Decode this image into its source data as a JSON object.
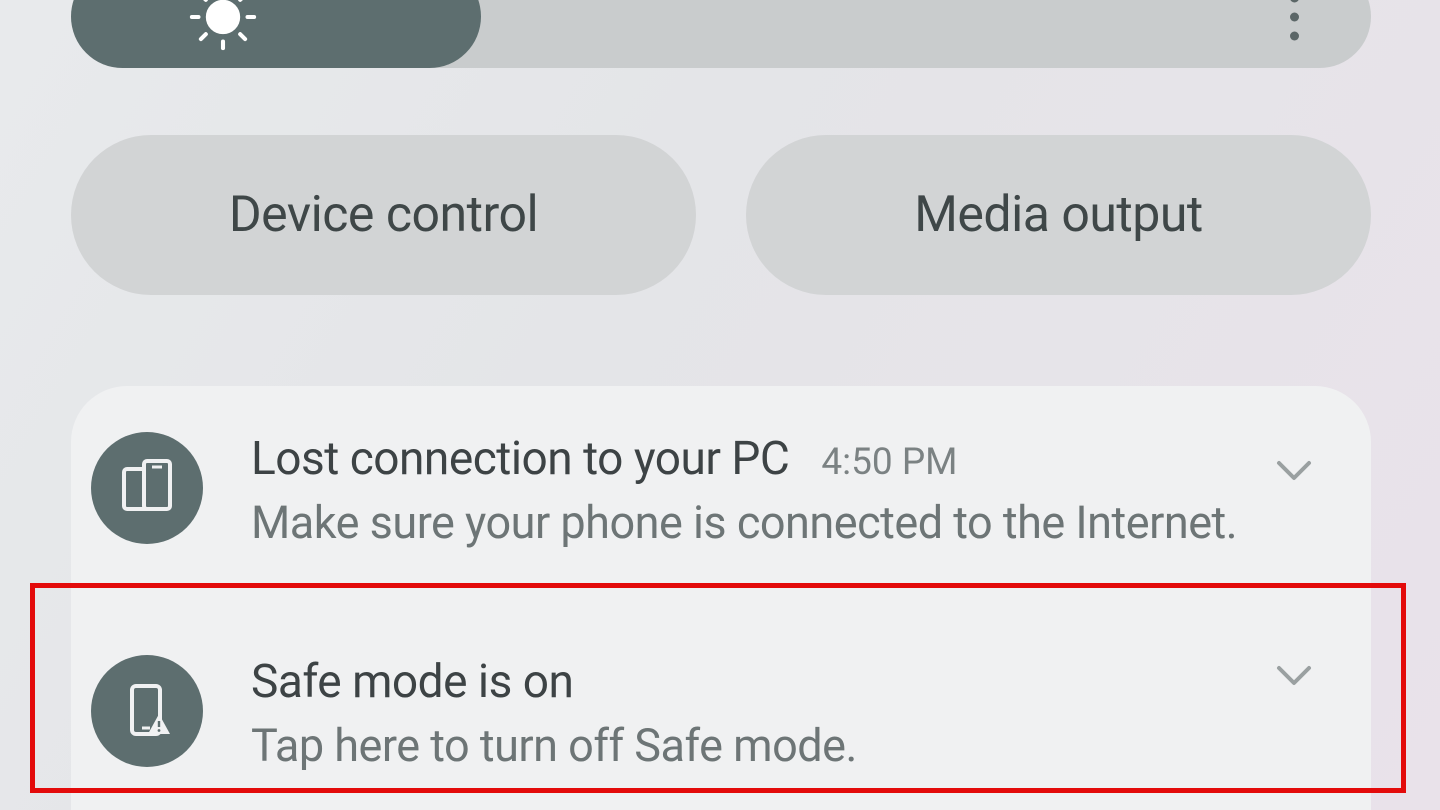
{
  "brightness": {
    "percent": 31
  },
  "pills": {
    "device_control": "Device control",
    "media_output": "Media output"
  },
  "notifications": [
    {
      "icon": "phone-link-icon",
      "title": "Lost connection to your PC",
      "time": "4:50 PM",
      "subtitle": "Make sure your phone is connected to the Internet."
    },
    {
      "icon": "safe-mode-icon",
      "title": "Safe mode is on",
      "time": "",
      "subtitle": "Tap here to turn off Safe mode."
    }
  ]
}
